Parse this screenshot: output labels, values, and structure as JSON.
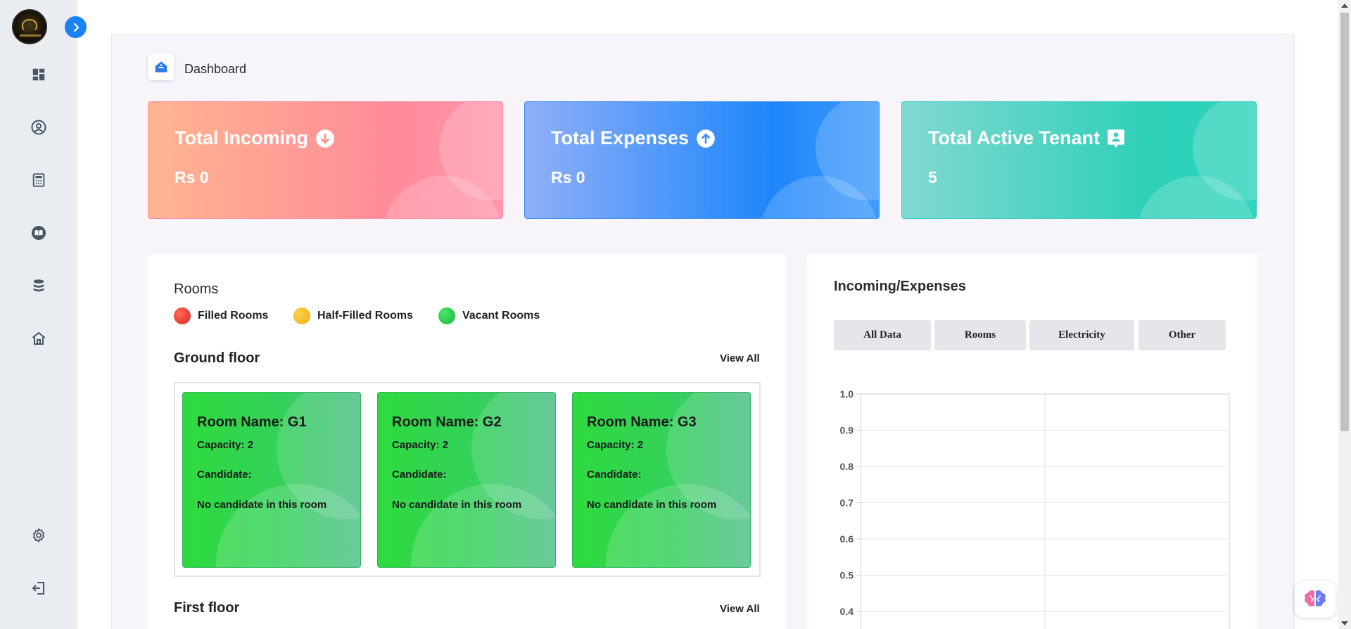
{
  "sidebar": {
    "icons": [
      "dashboard-icon",
      "user-circle-icon",
      "calculator-icon",
      "book-icon",
      "database-icon",
      "home-icon",
      "gear-icon",
      "logout-icon"
    ]
  },
  "breadcrumb": {
    "title": "Dashboard"
  },
  "stats": [
    {
      "title": "Total Incoming",
      "value": "Rs 0",
      "icon": "arrow-down-circle-icon"
    },
    {
      "title": "Total Expenses",
      "value": "Rs 0",
      "icon": "arrow-up-circle-icon"
    },
    {
      "title": "Total Active Tenant",
      "value": "5",
      "icon": "contact-badge-icon"
    }
  ],
  "rooms": {
    "title": "Rooms",
    "legend": [
      {
        "label": "Filled Rooms",
        "color": "#f0312f"
      },
      {
        "label": "Half-Filled Rooms",
        "color": "#f6b81d"
      },
      {
        "label": "Vacant Rooms",
        "color": "#22c541"
      }
    ],
    "floors": [
      {
        "title": "Ground floor",
        "view_all": "View All",
        "rooms": [
          {
            "name": "Room Name: G1",
            "capacity": "Capacity: 2",
            "candidate": "Candidate:",
            "status": "No candidate in this room"
          },
          {
            "name": "Room Name: G2",
            "capacity": "Capacity: 2",
            "candidate": "Candidate:",
            "status": "No candidate in this room"
          },
          {
            "name": "Room Name: G3",
            "capacity": "Capacity: 2",
            "candidate": "Candidate:",
            "status": "No candidate in this room"
          }
        ]
      },
      {
        "title": "First floor",
        "view_all": "View All"
      }
    ]
  },
  "incoming_expenses": {
    "title": "Incoming/Expenses",
    "tabs": [
      "All Data",
      "Rooms",
      "Electricity",
      "Other"
    ]
  },
  "chart_data": {
    "type": "line",
    "title": "",
    "xlabel": "",
    "ylabel": "",
    "ylim": [
      0,
      1.0
    ],
    "y_ticks": [
      "1.0",
      "0.9",
      "0.8",
      "0.7",
      "0.6",
      "0.5",
      "0.4"
    ],
    "series": [],
    "grid": true
  },
  "colors": {
    "accent": "#1a82f7",
    "sidebar_bg": "#e9edf2"
  }
}
